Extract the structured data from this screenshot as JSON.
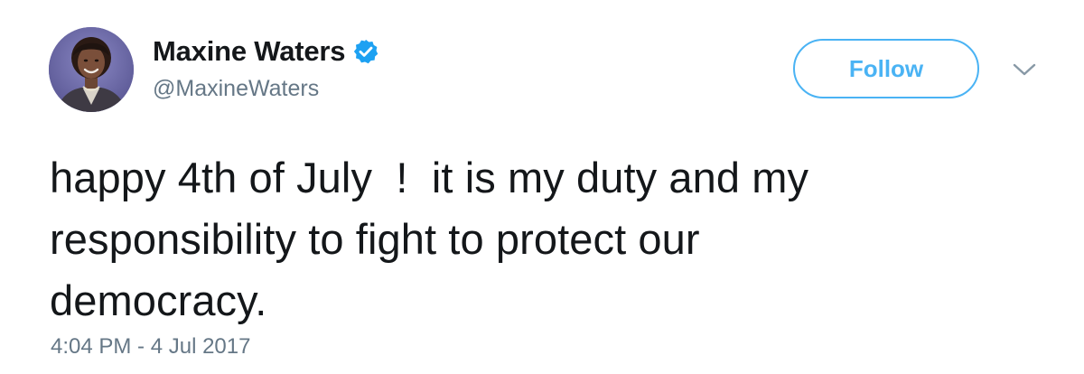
{
  "author": {
    "display_name": "Maxine Waters",
    "handle": "@MaxineWaters",
    "verified_icon": "verified-badge-icon",
    "avatar_icon": "profile-photo"
  },
  "actions": {
    "follow_label": "Follow",
    "menu_icon": "chevron-down-icon"
  },
  "tweet": {
    "text": "happy 4th of July  !  it is my duty and my\nresponsibility to fight to protect our\ndemocracy.",
    "timestamp": "4:04 PM - 4 Jul 2017"
  },
  "colors": {
    "text_primary": "#14171a",
    "text_secondary": "#657786",
    "accent": "#4ab3f4",
    "verified": "#1da1f2"
  }
}
